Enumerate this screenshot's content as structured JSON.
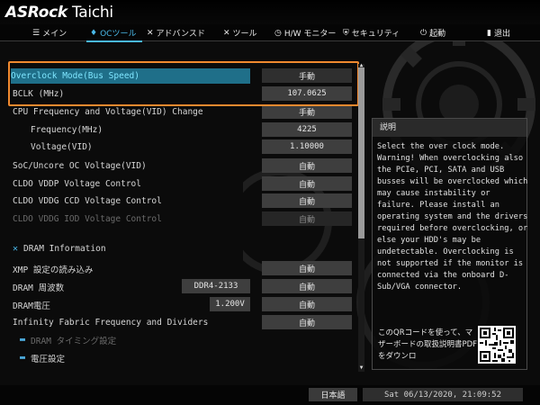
{
  "brand": {
    "name": "ASRock",
    "model": "Taichi"
  },
  "nav": {
    "tabs": [
      {
        "icon": "☰",
        "label": "メイン"
      },
      {
        "icon": "💧",
        "label": "OCツール"
      },
      {
        "icon": "✕",
        "label": "アドバンスド"
      },
      {
        "icon": "✕",
        "label": "ツール"
      },
      {
        "icon": "◷",
        "label": "H/W モニター"
      },
      {
        "icon": "⛨",
        "label": "セキュリティ"
      },
      {
        "icon": "⏻",
        "label": "起動"
      },
      {
        "icon": "▮",
        "label": "退出"
      }
    ],
    "active_index": 1
  },
  "settings": {
    "oc_mode": {
      "label": "Overclock Mode(Bus Speed)",
      "value": "手動"
    },
    "bclk": {
      "label": "BCLK (MHz)",
      "value": "107.0625"
    },
    "cpu_fv": {
      "label": "CPU Frequency and Voltage(VID) Change",
      "value": "手動"
    },
    "freq": {
      "label": "Frequency(MHz)",
      "value": "4225"
    },
    "vid": {
      "label": "Voltage(VID)",
      "value": "1.10000"
    },
    "soc": {
      "label": "SoC/Uncore OC Voltage(VID)",
      "value": "自動"
    },
    "cldo_vddp": {
      "label": "CLDO VDDP Voltage Control",
      "value": "自動"
    },
    "cldo_ccd": {
      "label": "CLDO VDDG CCD Voltage Control",
      "value": "自動"
    },
    "cldo_iod": {
      "label": "CLDO VDDG IOD Voltage Control",
      "value": "自動"
    },
    "dram_info": {
      "label": "DRAM Information"
    },
    "xmp": {
      "label": "XMP 設定の読み込み",
      "value": "自動"
    },
    "dram_freq": {
      "label": "DRAM 周波数",
      "info": "DDR4-2133",
      "value": "自動"
    },
    "dram_volt": {
      "label": "DRAM電圧",
      "info": "1.200V",
      "value": "自動"
    },
    "infinity": {
      "label": "Infinity Fabric Frequency and Dividers",
      "value": "自動"
    },
    "dram_timing": {
      "label": "DRAM タイミング設定"
    },
    "voltage": {
      "label": "電圧設定"
    }
  },
  "help": {
    "title": "説明",
    "text": "Select the over clock mode. Warning! When overclocking also the PCIe, PCI, SATA and USB busses will be overclocked which may cause instability or failure. Please install an operating system and the drivers required before overclocking, or else your HDD's may be undetectable. Overclocking is not supported if the monitor is connected via the onboard D-Sub/VGA connector."
  },
  "qr": {
    "text": "このQRコードを使って、マザーボードの取扱説明書PDFをダウンロ"
  },
  "status": {
    "language": "日本語",
    "datetime": "Sat 06/13/2020, 21:09:52"
  },
  "colors": {
    "accent": "#49b8e8",
    "highlight_box": "#f0892f",
    "selected_row": "#1f6f89"
  }
}
